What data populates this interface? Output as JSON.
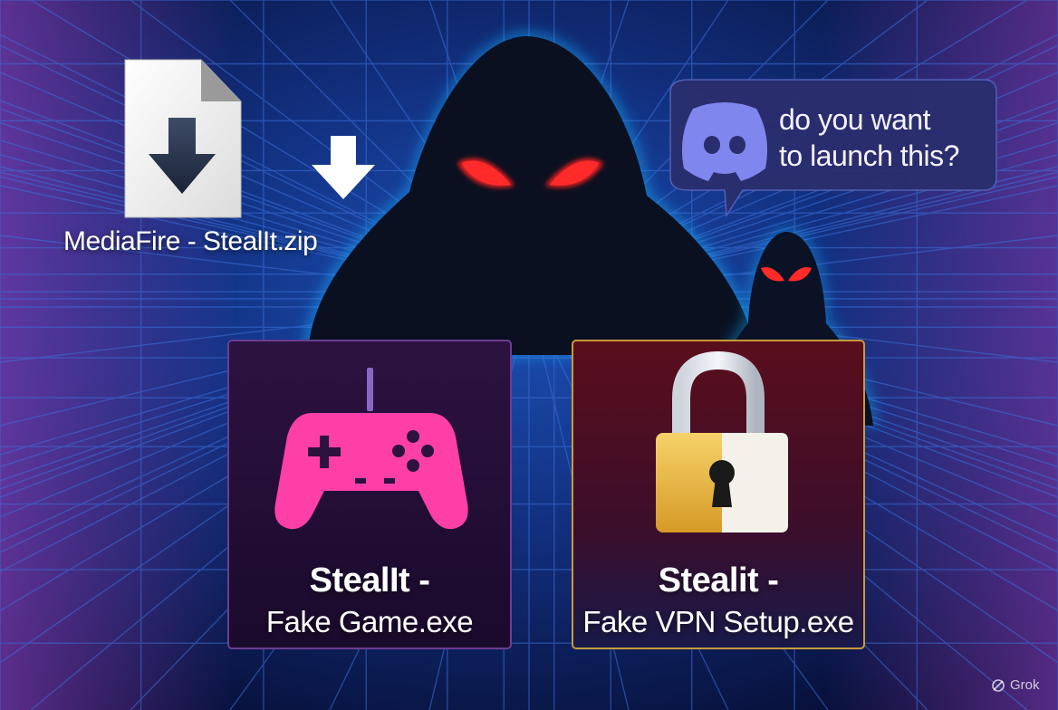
{
  "file": {
    "label": "MediaFire - StealIt.zip",
    "icon": "download-file-icon"
  },
  "chat": {
    "icon": "discord-icon",
    "line1": "do you want",
    "line2": "to launch this?"
  },
  "cards": [
    {
      "title": "StealIt -",
      "subtitle": "Fake Game.exe",
      "icon": "gamepad-icon",
      "accent": "#ff3fa8"
    },
    {
      "title": "Stealit -",
      "subtitle": "Fake VPN Setup.exe",
      "icon": "padlock-icon",
      "accent": "#e8b83a"
    }
  ],
  "watermark": {
    "label": "Grok"
  },
  "colors": {
    "background": "#081640",
    "grid": "#3a6fd8",
    "eyes": "#ff2020"
  }
}
